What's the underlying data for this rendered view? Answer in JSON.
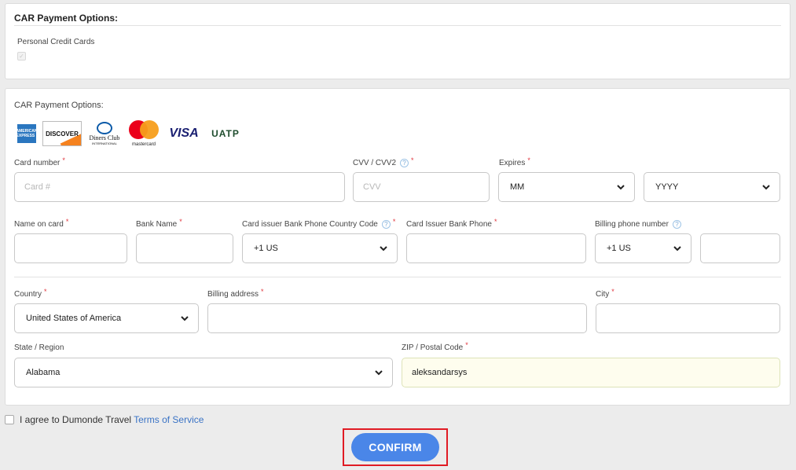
{
  "section1": {
    "title": "CAR Payment Options:",
    "personal_cards_label": "Personal Credit Cards",
    "checkbox_mark": "✓"
  },
  "section2": {
    "title": "CAR Payment Options:",
    "card_logos": {
      "amex": "AMERICAN EXPRESS",
      "discover": "DISCOVER",
      "diners_line1": "Diners Club",
      "diners_line2": "INTERNATIONAL",
      "mastercard": "mastercard",
      "visa": "VISA",
      "uatp": "UATP"
    },
    "fields": {
      "card_number": {
        "label": "Card number",
        "placeholder": "Card #"
      },
      "cvv": {
        "label": "CVV / CVV2",
        "placeholder": "CVV"
      },
      "expires": {
        "label": "Expires",
        "month": "MM",
        "year": "YYYY"
      },
      "name_on_card": {
        "label": "Name on card",
        "value": ""
      },
      "bank_name": {
        "label": "Bank Name",
        "value": ""
      },
      "issuer_country_code": {
        "label": "Card issuer Bank Phone Country Code",
        "value": "+1 US"
      },
      "issuer_phone": {
        "label": "Card Issuer Bank Phone",
        "value": ""
      },
      "billing_phone": {
        "label": "Billing phone number",
        "code": "+1 US",
        "value": ""
      },
      "country": {
        "label": "Country",
        "value": "United States of America"
      },
      "billing_address": {
        "label": "Billing address",
        "value": ""
      },
      "city": {
        "label": "City",
        "value": ""
      },
      "state": {
        "label": "State / Region",
        "value": "Alabama"
      },
      "zip": {
        "label": "ZIP / Postal Code",
        "value": "aleksandarsys"
      }
    },
    "required_mark": "*",
    "help_mark": "?"
  },
  "terms": {
    "text": "I agree to Dumonde Travel",
    "link": "Terms of Service"
  },
  "confirm_label": "CONFIRM",
  "colors": {
    "accent": "#4a86e8",
    "required": "#e0343c",
    "highlight_border": "#e01b24",
    "autofill_bg": "#fefdee"
  }
}
